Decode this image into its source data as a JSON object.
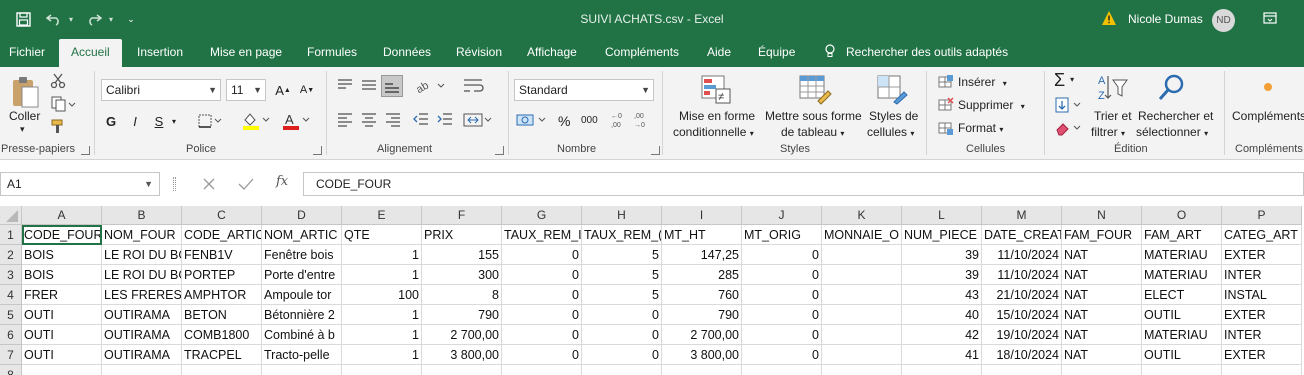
{
  "window": {
    "title": "SUIVI ACHATS.csv  -  Excel",
    "user": "Nicole Dumas",
    "user_initials": "ND"
  },
  "tabs": [
    "Fichier",
    "Accueil",
    "Insertion",
    "Mise en page",
    "Formules",
    "Données",
    "Révision",
    "Affichage",
    "Compléments",
    "Aide",
    "Équipe",
    "Rechercher des outils adaptés"
  ],
  "active_tab": "Accueil",
  "ribbon": {
    "clipboard": {
      "paste": "Coller",
      "label": "Presse-papiers"
    },
    "font": {
      "name": "Calibri",
      "size": "11",
      "label": "Police",
      "bold": "G",
      "italic": "I",
      "underline": "S"
    },
    "alignment": {
      "label": "Alignement"
    },
    "number": {
      "format": "Standard",
      "label": "Nombre",
      "percent": "%",
      "thousands": "000"
    },
    "styles": {
      "conditional": [
        "Mise en forme",
        "conditionnelle"
      ],
      "table": [
        "Mettre sous forme",
        "de tableau"
      ],
      "cell_styles": [
        "Styles de",
        "cellules"
      ],
      "label": "Styles"
    },
    "cells": {
      "insert": "Insérer",
      "delete": "Supprimer",
      "format": "Format",
      "label": "Cellules"
    },
    "editing": {
      "sort": [
        "Trier et",
        "filtrer"
      ],
      "find": [
        "Rechercher et",
        "sélectionner"
      ],
      "label": "Édition"
    },
    "addins": {
      "button": "Compléments",
      "label": "Compléments"
    }
  },
  "formula_bar": {
    "name_box": "A1",
    "fx": "fx",
    "content": "CODE_FOUR"
  },
  "grid": {
    "columns": [
      "A",
      "B",
      "C",
      "D",
      "E",
      "F",
      "G",
      "H",
      "I",
      "J",
      "K",
      "L",
      "M",
      "N",
      "O",
      "P"
    ],
    "rows": [
      "1",
      "2",
      "3",
      "4",
      "5",
      "6",
      "7",
      "8"
    ],
    "cells": [
      [
        "CODE_FOUR",
        "NOM_FOUR",
        "CODE_ARTIC",
        "NOM_ARTIC",
        "QTE",
        "PRIX",
        "TAUX_REM_I",
        "TAUX_REM_(",
        "MT_HT",
        "MT_ORIG",
        "MONNAIE_O",
        "NUM_PIECE",
        "DATE_CREAT",
        "FAM_FOUR",
        "FAM_ART",
        "CATEG_ART"
      ],
      [
        "BOIS",
        "LE ROI DU BC",
        "FENB1V",
        "Fenêtre bois",
        "1",
        "155",
        "0",
        "5",
        "147,25",
        "0",
        "",
        "39",
        "11/10/2024",
        "NAT",
        "MATERIAU",
        "EXTER"
      ],
      [
        "BOIS",
        "LE ROI DU BC",
        "PORTEP",
        "Porte d'entre",
        "1",
        "300",
        "0",
        "5",
        "285",
        "0",
        "",
        "39",
        "11/10/2024",
        "NAT",
        "MATERIAU",
        "INTER"
      ],
      [
        "FRER",
        "LES FRERES L",
        "AMPHTOR",
        "Ampoule tor",
        "100",
        "8",
        "0",
        "5",
        "760",
        "0",
        "",
        "43",
        "21/10/2024",
        "NAT",
        "ELECT",
        "INSTAL"
      ],
      [
        "OUTI",
        "OUTIRAMA",
        "BETON",
        "Bétonnière 2",
        "1",
        "790",
        "0",
        "0",
        "790",
        "0",
        "",
        "40",
        "15/10/2024",
        "NAT",
        "OUTIL",
        "EXTER"
      ],
      [
        "OUTI",
        "OUTIRAMA",
        "COMB1800",
        "Combiné à b",
        "1",
        "2 700,00",
        "0",
        "0",
        "2 700,00",
        "0",
        "",
        "42",
        "19/10/2024",
        "NAT",
        "MATERIAU",
        "INTER"
      ],
      [
        "OUTI",
        "OUTIRAMA",
        "TRACPEL",
        "Tracto-pelle",
        "1",
        "3 800,00",
        "0",
        "0",
        "3 800,00",
        "0",
        "",
        "41",
        "18/10/2024",
        "NAT",
        "OUTIL",
        "EXTER"
      ]
    ],
    "numeric_columns": [
      4,
      5,
      6,
      7,
      8,
      9,
      11,
      12
    ]
  }
}
